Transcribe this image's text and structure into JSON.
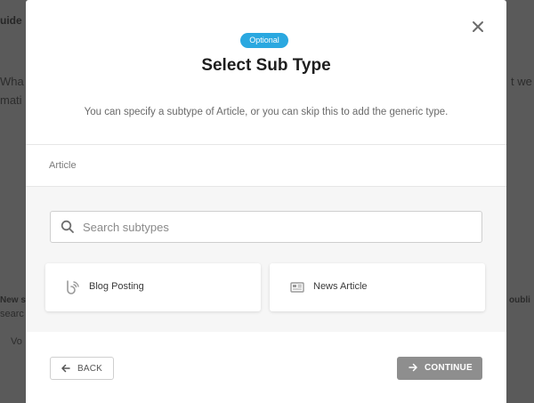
{
  "background": {
    "fragments": [
      "uide",
      "Wha",
      "mati",
      "t we",
      "New s",
      "searc",
      "Vo",
      "oubli"
    ]
  },
  "modal": {
    "badge": "Optional",
    "title": "Select Sub Type",
    "subtitle": "You can specify a subtype of Article, or you can skip this to add the generic type.",
    "breadcrumb": "Article",
    "search": {
      "placeholder": "Search subtypes",
      "value": ""
    },
    "subtypes": [
      {
        "label": "Blog Posting",
        "icon": "blog-posting-icon"
      },
      {
        "label": "News Article",
        "icon": "news-article-icon"
      }
    ],
    "back_label": "BACK",
    "continue_label": "CONTINUE",
    "colors": {
      "badge": "#2aa8e0",
      "continue": "#8e8e8e"
    }
  }
}
